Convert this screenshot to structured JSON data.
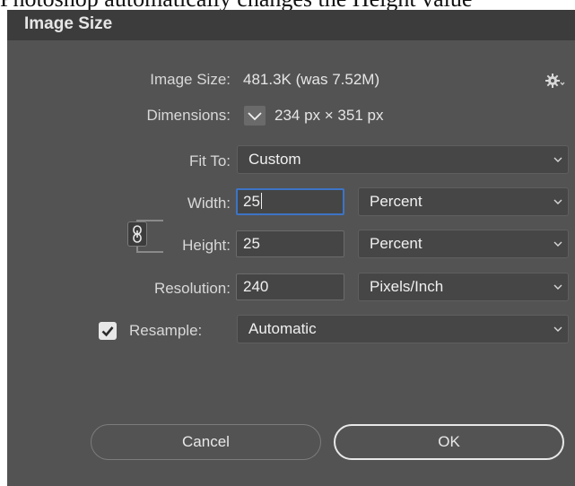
{
  "caption": "Photoshop automatically changes the Height value",
  "dialog": {
    "title": "Image Size",
    "image_size": {
      "label": "Image Size:",
      "value": "481.3K (was 7.52M)"
    },
    "dimensions": {
      "label": "Dimensions:",
      "value": "234 px  ×  351 px"
    },
    "fit_to": {
      "label": "Fit To:",
      "selected": "Custom"
    },
    "width": {
      "label": "Width:",
      "value": "25",
      "unit": "Percent"
    },
    "height": {
      "label": "Height:",
      "value": "25",
      "unit": "Percent"
    },
    "resolution": {
      "label": "Resolution:",
      "value": "240",
      "unit": "Pixels/Inch"
    },
    "resample": {
      "label": "Resample:",
      "checked": true,
      "selected": "Automatic"
    },
    "buttons": {
      "cancel": "Cancel",
      "ok": "OK"
    }
  },
  "colors": {
    "dialog_bg": "#535353",
    "titlebar_bg": "#3c3c3c",
    "focus_accent": "#3d74c6"
  },
  "icons": {
    "settings": "gear-icon",
    "dimensions_toggle": "chevron-down-icon",
    "constrain_proportions": "chain-link-icon",
    "resample_check": "checkmark-icon"
  }
}
